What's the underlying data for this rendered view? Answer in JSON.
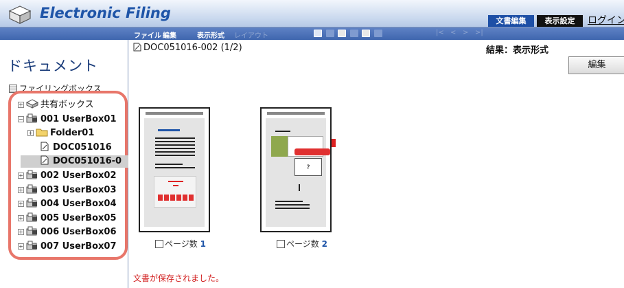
{
  "header": {
    "title": "Electronic Filing",
    "btn_edit_doc": "文書編集",
    "btn_display": "表示設定",
    "btn_login": "ログイン"
  },
  "toolbar": {
    "menus": [
      "ファイル",
      "編集",
      "表示形式",
      "レイアウト"
    ],
    "nav": [
      "|<",
      "<",
      ">",
      ">|"
    ]
  },
  "sidebar": {
    "title": "ドキュメント",
    "filing_box": "ファイリングボックス",
    "tree": [
      {
        "label": "共有ボックス",
        "toggle": "+",
        "icon": "shared-box-icon"
      },
      {
        "label": "001 UserBox01",
        "toggle": "−",
        "icon": "user-box-icon"
      },
      {
        "label": "Folder01",
        "toggle": "+",
        "icon": "folder-icon"
      },
      {
        "label": "DOC051016",
        "toggle": "",
        "icon": "document-icon"
      },
      {
        "label": "DOC051016-0",
        "toggle": "",
        "icon": "document-icon",
        "selected": true
      },
      {
        "label": "002 UserBox02",
        "toggle": "+",
        "icon": "user-box-icon"
      },
      {
        "label": "003 UserBox03",
        "toggle": "+",
        "icon": "user-box-icon"
      },
      {
        "label": "004 UserBox04",
        "toggle": "+",
        "icon": "user-box-icon"
      },
      {
        "label": "005 UserBox05",
        "toggle": "+",
        "icon": "user-box-icon"
      },
      {
        "label": "006 UserBox06",
        "toggle": "+",
        "icon": "user-box-icon"
      },
      {
        "label": "007 UserBox07",
        "toggle": "+",
        "icon": "user-box-icon"
      }
    ]
  },
  "main": {
    "doc_title": "DOC051016-002 (1/2)",
    "result_label": "結果：表示形式",
    "edit_button": "編集",
    "pages": [
      {
        "label": "ページ数",
        "number": "1"
      },
      {
        "label": "ページ数",
        "number": "2"
      }
    ],
    "status": "文書が保存されました。"
  },
  "colors": {
    "accent": "#1f55a8",
    "highlight": "#e8766a",
    "status": "#d21f1f"
  }
}
